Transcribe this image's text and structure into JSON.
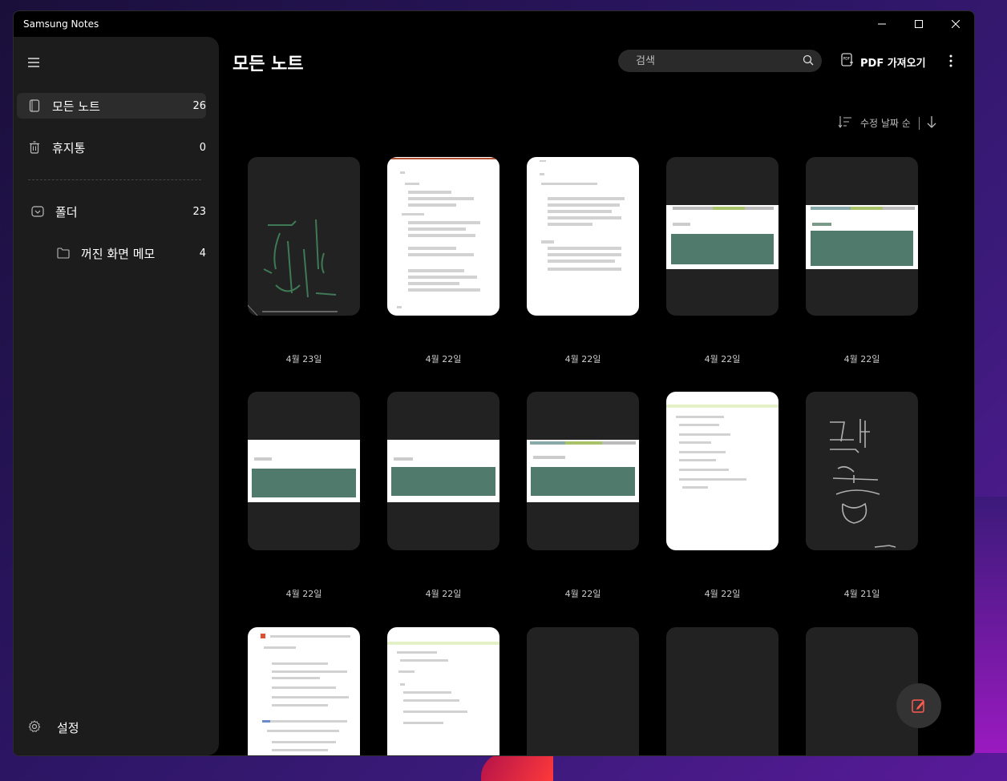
{
  "window": {
    "title": "Samsung Notes"
  },
  "sidebar": {
    "items": [
      {
        "label": "모든 노트",
        "count": "26",
        "icon": "notebook-icon"
      },
      {
        "label": "휴지통",
        "count": "0",
        "icon": "trash-icon"
      }
    ],
    "folders_label": "폴더",
    "folders_count": "23",
    "subfolder": {
      "label": "꺼진 화면 메모",
      "count": "4"
    },
    "settings_label": "설정"
  },
  "header": {
    "title": "모든 노트",
    "search_placeholder": "검색",
    "pdf_label": "PDF 가져오기"
  },
  "sort": {
    "label": "수정 날짜 순"
  },
  "notes": [
    {
      "date": "4월 23일",
      "kind": "sketch"
    },
    {
      "date": "4월 22일",
      "kind": "doc"
    },
    {
      "date": "4월 22일",
      "kind": "doc"
    },
    {
      "date": "4월 22일",
      "kind": "banner"
    },
    {
      "date": "4월 22일",
      "kind": "banner"
    },
    {
      "date": "4월 22일",
      "kind": "banner"
    },
    {
      "date": "4월 22일",
      "kind": "banner"
    },
    {
      "date": "4월 22일",
      "kind": "banner"
    },
    {
      "date": "4월 22일",
      "kind": "doc"
    },
    {
      "date": "4월 21일",
      "kind": "handwriting"
    },
    {
      "date": "",
      "kind": "doc"
    },
    {
      "date": "",
      "kind": "doc"
    },
    {
      "date": "",
      "kind": "blank"
    },
    {
      "date": "",
      "kind": "blank"
    },
    {
      "date": "",
      "kind": "blank"
    }
  ],
  "colors": {
    "accent": "#ff5a4e",
    "thumb_green": "#4f7a6c"
  }
}
